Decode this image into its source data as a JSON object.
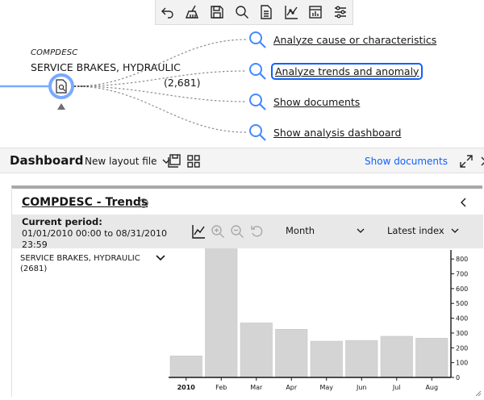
{
  "toolbar": {
    "buttons": [
      {
        "icon": "undo-icon"
      },
      {
        "icon": "broom-clear-icon"
      },
      {
        "icon": "save-icon"
      },
      {
        "icon": "search-icon"
      },
      {
        "icon": "document-icon"
      },
      {
        "icon": "line-chart-icon"
      },
      {
        "icon": "calendar-chart-icon"
      },
      {
        "icon": "settings-sliders-icon"
      }
    ]
  },
  "graph": {
    "node": {
      "category": "COMPDESC",
      "title": "SERVICE BRAKES, HYDRAULIC",
      "count": "(2,681)"
    },
    "actions": [
      {
        "label": "Analyze cause or characteristics"
      },
      {
        "label": "Analyze trends and anomaly"
      },
      {
        "label": "Show documents"
      },
      {
        "label": "Show analysis dashboard"
      }
    ]
  },
  "dashboard": {
    "title": "Dashboard",
    "layout_select": "New layout file",
    "show_documents": "Show documents"
  },
  "card": {
    "title": "COMPDESC - Trends",
    "period_label": "Current period:",
    "period_value": "01/01/2010 00:00 to 08/31/2010 23:59",
    "interval_select": "Month",
    "index_select": "Latest index",
    "series_label": "SERVICE BRAKES, HYDRAULIC",
    "series_count": "(2681)"
  },
  "colors": {
    "accent": "#0f62fe",
    "node_ring": "#78a9ff",
    "bar": "#d4d4d4"
  },
  "chart_data": {
    "type": "bar",
    "categories": [
      "2010",
      "Feb",
      "Mar",
      "Apr",
      "May",
      "Jun",
      "Jul",
      "Aug"
    ],
    "values": [
      145,
      880,
      368,
      325,
      245,
      250,
      278,
      265
    ],
    "ylim": [
      0,
      850
    ],
    "yticks": [
      0,
      100,
      200,
      300,
      400,
      500,
      600,
      700,
      800
    ],
    "bold_categories": [
      "2010"
    ]
  }
}
